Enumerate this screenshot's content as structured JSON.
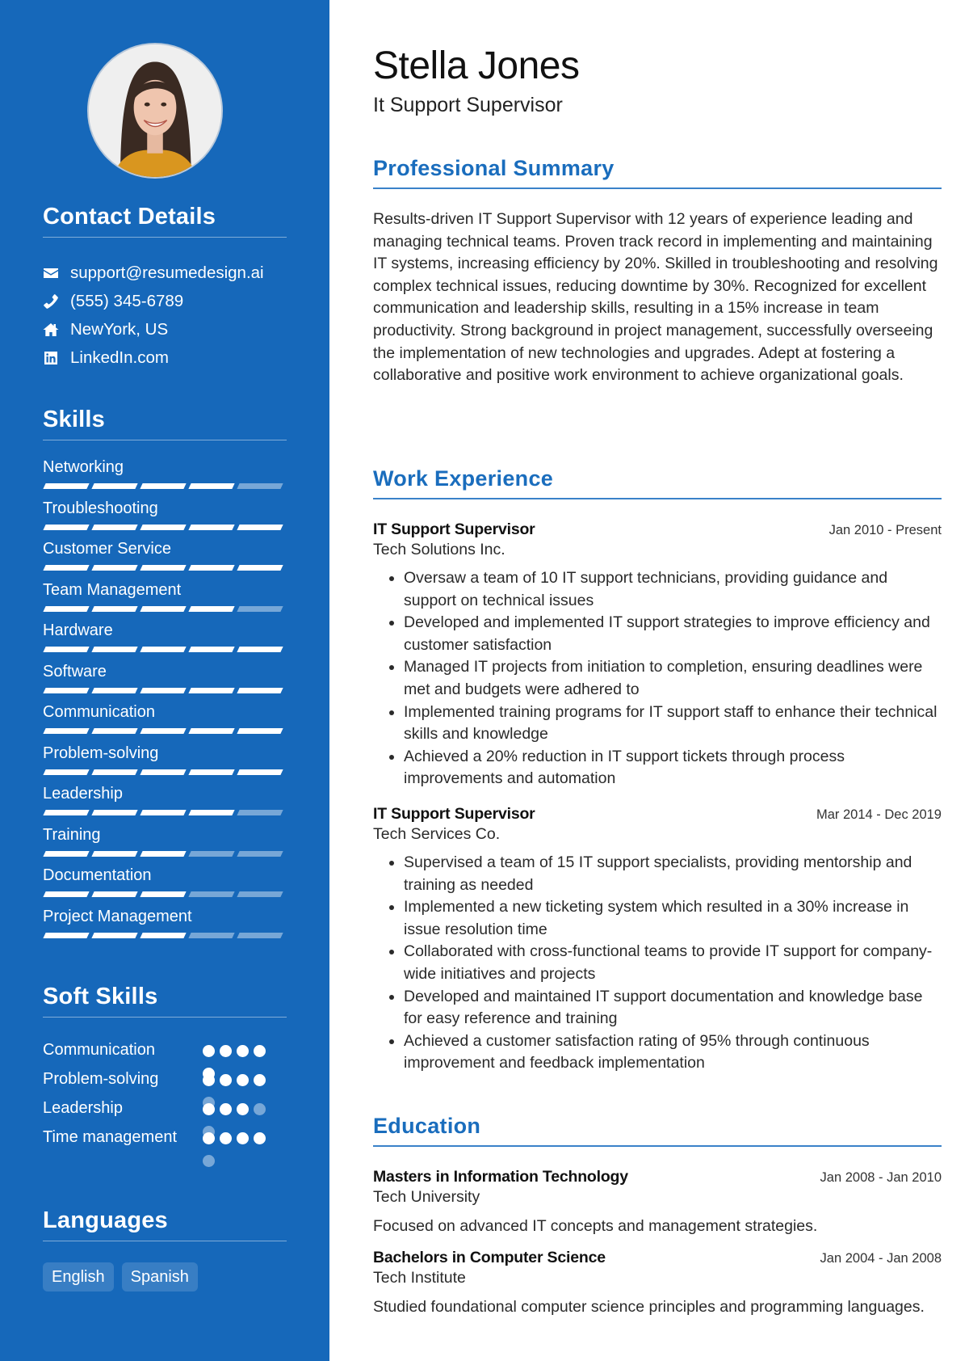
{
  "colors": {
    "sidebar_bg": "#1668ba",
    "accent": "#1a6dbd",
    "text": "#222222"
  },
  "profile": {
    "name": "Stella Jones",
    "title": "It Support Supervisor",
    "photo_alt": "profile-photo"
  },
  "contact": {
    "heading": "Contact Details",
    "items": [
      {
        "icon": "envelope-icon",
        "text": "support@resumedesign.ai"
      },
      {
        "icon": "phone-icon",
        "text": "(555) 345-6789"
      },
      {
        "icon": "home-icon",
        "text": "NewYork, US"
      },
      {
        "icon": "linkedin-icon",
        "text": "LinkedIn.com"
      }
    ]
  },
  "skills": {
    "heading": "Skills",
    "max": 5,
    "items": [
      {
        "label": "Networking",
        "level": 4
      },
      {
        "label": "Troubleshooting",
        "level": 5
      },
      {
        "label": "Customer Service",
        "level": 5
      },
      {
        "label": "Team Management",
        "level": 4
      },
      {
        "label": "Hardware",
        "level": 5
      },
      {
        "label": "Software",
        "level": 5
      },
      {
        "label": "Communication",
        "level": 5
      },
      {
        "label": "Problem-solving",
        "level": 5
      },
      {
        "label": "Leadership",
        "level": 4
      },
      {
        "label": "Training",
        "level": 3
      },
      {
        "label": "Documentation",
        "level": 3
      },
      {
        "label": "Project Management",
        "level": 3
      }
    ]
  },
  "soft_skills": {
    "heading": "Soft Skills",
    "max": 5,
    "items": [
      {
        "label": "Communication",
        "level": 5
      },
      {
        "label": "Problem-solving",
        "level": 4
      },
      {
        "label": "Leadership",
        "level": 3
      },
      {
        "label": "Time management",
        "level": 4
      }
    ]
  },
  "languages": {
    "heading": "Languages",
    "items": [
      "English",
      "Spanish"
    ]
  },
  "summary": {
    "heading": "Professional Summary",
    "text": "Results-driven IT Support Supervisor with 12 years of experience leading and managing technical teams. Proven track record in implementing and maintaining IT systems, increasing efficiency by 20%. Skilled in troubleshooting and resolving complex technical issues, reducing downtime by 30%. Recognized for excellent communication and leadership skills, resulting in a 15% increase in team productivity. Strong background in project management, successfully overseeing the implementation of new technologies and upgrades. Adept at fostering a collaborative and positive work environment to achieve organizational goals."
  },
  "experience": {
    "heading": "Work Experience",
    "items": [
      {
        "title": "IT Support Supervisor",
        "company": "Tech Solutions Inc.",
        "dates": "Jan 2010 - Present",
        "bullets": [
          "Oversaw a team of 10 IT support technicians, providing guidance and support on technical issues",
          "Developed and implemented IT support strategies to improve efficiency and customer satisfaction",
          "Managed IT projects from initiation to completion, ensuring deadlines were met and budgets were adhered to",
          "Implemented training programs for IT support staff to enhance their technical skills and knowledge",
          "Achieved a 20% reduction in IT support tickets through process improvements and automation"
        ]
      },
      {
        "title": "IT Support Supervisor",
        "company": "Tech Services Co.",
        "dates": "Mar 2014 - Dec 2019",
        "bullets": [
          "Supervised a team of 15 IT support specialists, providing mentorship and training as needed",
          "Implemented a new ticketing system which resulted in a 30% increase in issue resolution time",
          "Collaborated with cross-functional teams to provide IT support for company-wide initiatives and projects",
          "Developed and maintained IT support documentation and knowledge base for easy reference and training",
          "Achieved a customer satisfaction rating of 95% through continuous improvement and feedback implementation"
        ]
      }
    ]
  },
  "education": {
    "heading": "Education",
    "items": [
      {
        "degree": "Masters in Information Technology",
        "school": "Tech University",
        "dates": "Jan 2008 - Jan 2010",
        "description": "Focused on advanced IT concepts and management strategies."
      },
      {
        "degree": "Bachelors in Computer Science",
        "school": "Tech Institute",
        "dates": "Jan 2004 - Jan 2008",
        "description": "Studied foundational computer science principles and programming languages."
      }
    ]
  }
}
